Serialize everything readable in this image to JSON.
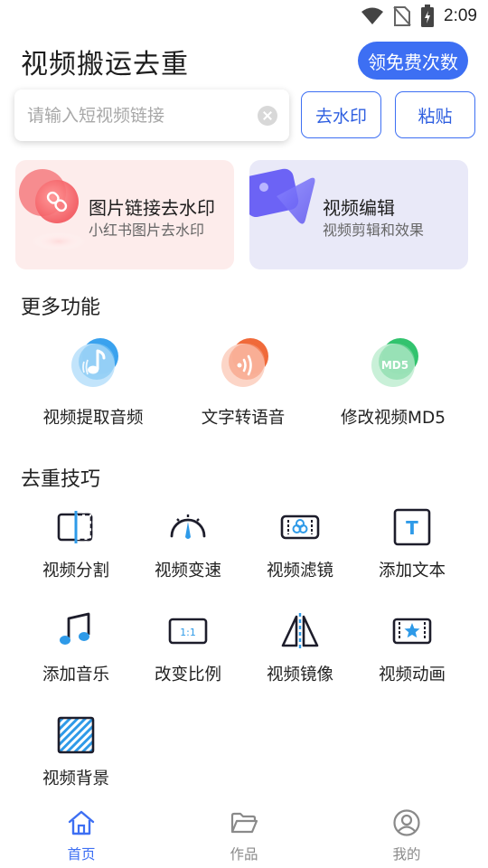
{
  "status": {
    "time": "2:09"
  },
  "header": {
    "title": "视频搬运去重",
    "free_button": "领免费次数"
  },
  "search": {
    "placeholder": "请输入短视频链接",
    "value": ""
  },
  "actions": {
    "remove_watermark": "去水印",
    "paste": "粘贴"
  },
  "cards": [
    {
      "title": "图片链接去水印",
      "subtitle": "小红书图片去水印"
    },
    {
      "title": "视频编辑",
      "subtitle": "视频剪辑和效果"
    }
  ],
  "more": {
    "title": "更多功能",
    "items": [
      {
        "label": "视频提取音频",
        "icon": "music-note-icon"
      },
      {
        "label": "文字转语音",
        "icon": "sound-wave-icon"
      },
      {
        "label": "修改视频MD5",
        "icon": "md5-icon",
        "badge": "MD5"
      }
    ]
  },
  "tips": {
    "title": "去重技巧",
    "items": [
      {
        "label": "视频分割",
        "icon": "split-icon"
      },
      {
        "label": "视频变速",
        "icon": "speedometer-icon"
      },
      {
        "label": "视频滤镜",
        "icon": "filter-icon"
      },
      {
        "label": "添加文本",
        "icon": "text-icon",
        "glyph": "T"
      },
      {
        "label": "添加音乐",
        "icon": "music-icon"
      },
      {
        "label": "改变比例",
        "icon": "ratio-icon",
        "glyph": "1:1"
      },
      {
        "label": "视频镜像",
        "icon": "mirror-icon"
      },
      {
        "label": "视频动画",
        "icon": "animation-icon"
      },
      {
        "label": "视频背景",
        "icon": "background-icon"
      }
    ]
  },
  "tabbar": {
    "items": [
      {
        "label": "首页",
        "icon": "home-icon",
        "active": true
      },
      {
        "label": "作品",
        "icon": "folder-icon",
        "active": false
      },
      {
        "label": "我的",
        "icon": "profile-icon",
        "active": false
      }
    ]
  },
  "colors": {
    "accent": "#3d6ff3",
    "pink_card": "#fdeceb",
    "purple_card": "#e9e9f8"
  }
}
